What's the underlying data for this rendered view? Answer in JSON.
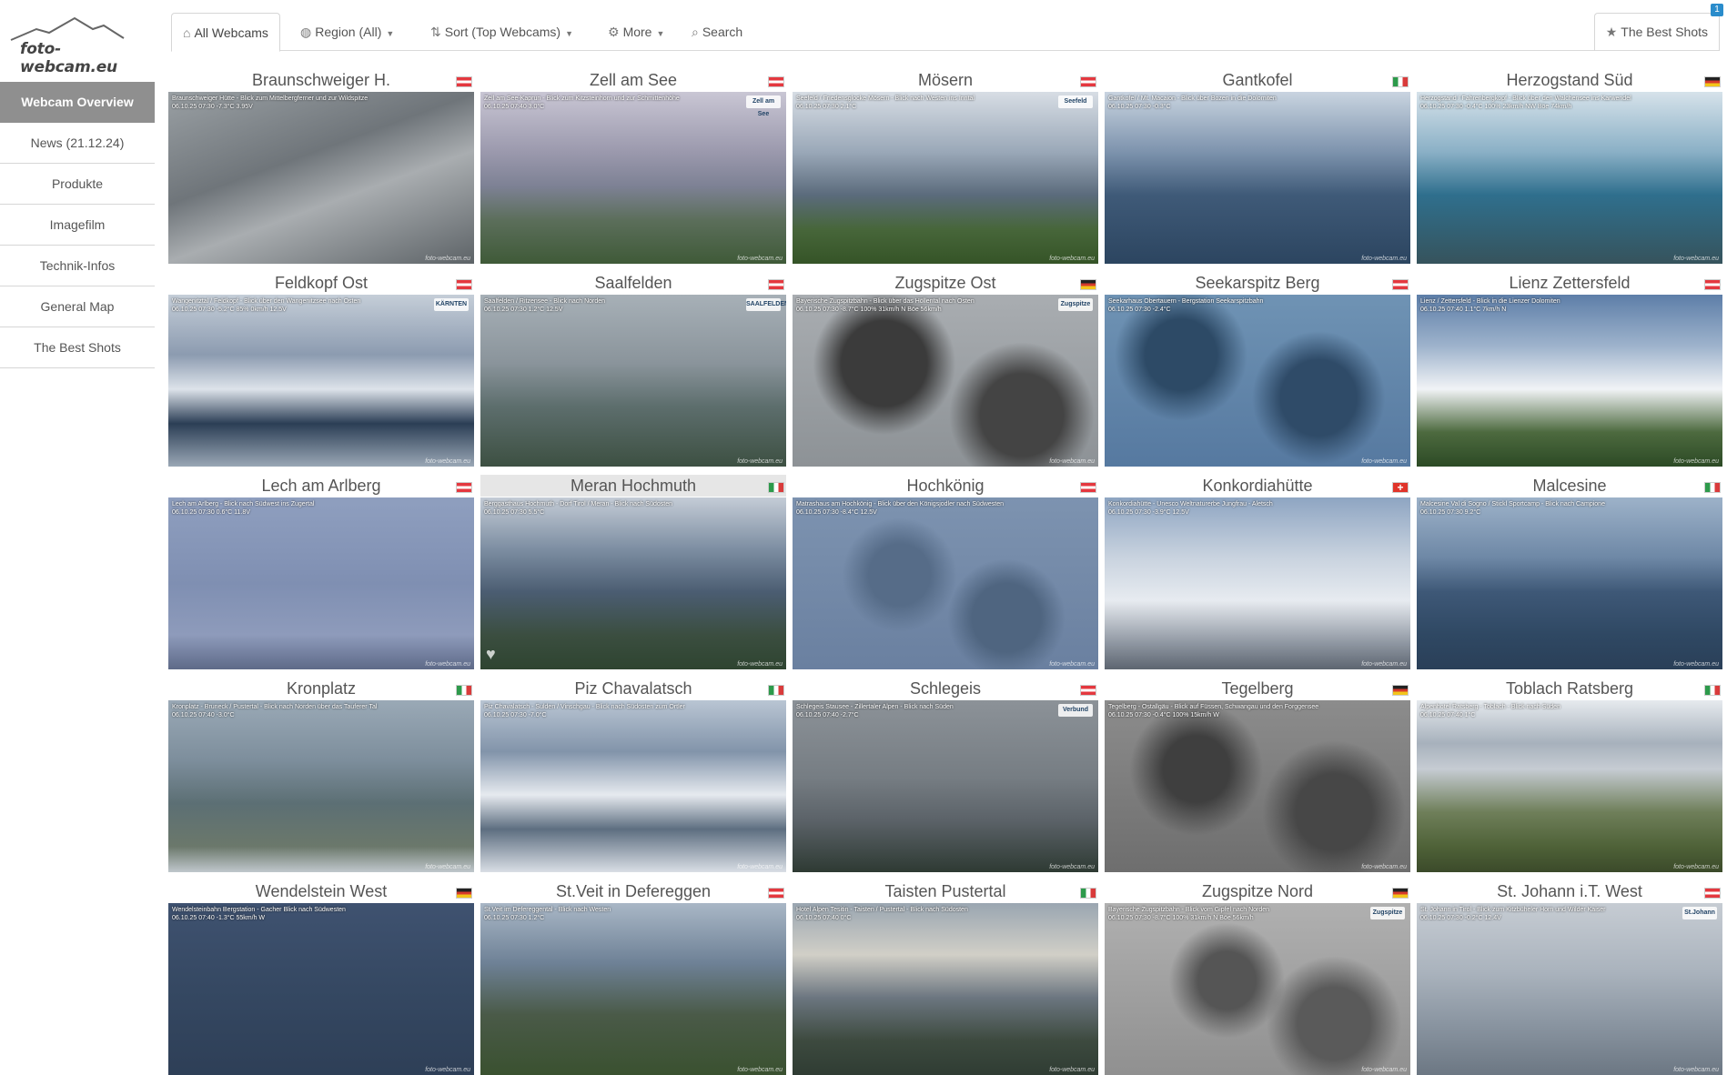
{
  "brand": {
    "name": "foto-webcam.eu"
  },
  "sidebar": {
    "items": [
      {
        "label": "Webcam Overview",
        "active": true
      },
      {
        "label": "News (21.12.24)"
      },
      {
        "label": "Produkte"
      },
      {
        "label": "Imagefilm"
      },
      {
        "label": "Technik-Infos"
      },
      {
        "label": "General Map"
      },
      {
        "label": "The Best Shots"
      }
    ]
  },
  "nav": {
    "all": "All Webcams",
    "region": "Region (All)",
    "sort": "Sort (Top Webcams)",
    "more": "More",
    "search": "Search",
    "best": "The Best Shots",
    "corner": "1"
  },
  "webcams": [
    {
      "title": "Braunschweiger H.",
      "flag": "at",
      "caption": "Braunschweiger Hütte - Blick zum Mittelbergferner und zur Wildspitze",
      "stats": "06.10.25 07:30  -7.3°C  3.95V",
      "bg": "linear-gradient(160deg,#9aa0a4 0%,#6f757a 40%,#a9adb0 60%,#5d6367 100%)"
    },
    {
      "title": "Zell am See",
      "flag": "at",
      "caption": "Zell am See-Kaprun - Blick zum Kitzsteinhorn und zur Schmittenhöhe",
      "stats": "06.10.25 07:40  3.0°C",
      "logo": "Zell am See",
      "bg": "linear-gradient(180deg,#c9c6d4 0%,#9b99ad 35%,#7d8194 55%,#5b6e5a 75%,#3f5a38 100%)"
    },
    {
      "title": "Mösern",
      "flag": "at",
      "caption": "Seefeld / Friedensglocke Mösern - Blick nach Westen ins Inntal",
      "stats": "06.10.25 07:30  2.1°C",
      "logo": "Seefeld",
      "bg": "linear-gradient(180deg,#d7dde4 0%,#9aa8b8 35%,#5b6b7c 60%,#47663a 80%,#355427 100%)"
    },
    {
      "title": "Gantkofel",
      "flag": "it",
      "caption": "Gantkofel / Mt. Macaion - Blick über Bozen in die Dolomiten",
      "stats": "06.10.25 07:30  -0.3°C",
      "bg": "linear-gradient(180deg,#c9d4e0 0%,#7d93ad 35%,#3f5a78 60%,#2c4560 100%)"
    },
    {
      "title": "Herzogstand Süd",
      "flag": "de",
      "caption": "Herzogstand / Fahrenbergkopf - Blick über den Walchensee ins Karwendel",
      "stats": "06.10.25 07:30  -0.4°C  100%  23km/h NW  Böe 74km/h",
      "bg": "linear-gradient(180deg,#d6e2ea 0%,#8ab0c6 35%,#2f6f8d 60%,#36535c 100%)"
    },
    {
      "title": "Feldkopf Ost",
      "flag": "at",
      "caption": "Wangenitztal / Feldkopf - Blick über den Wangenitzsee nach Osten",
      "stats": "06.10.25 07:30  -5.2°C  85%  0km/h  12.5V",
      "logo": "KÄRNTEN",
      "bg": "linear-gradient(180deg,#c5ced8 0%,#8c9bb0 35%,#dde3ea 55%,#2b3e55 75%,#9aa7b5 100%)"
    },
    {
      "title": "Saalfelden",
      "flag": "at",
      "caption": "Saalfelden / Ritzensee - Blick nach Norden",
      "stats": "06.10.25 07:30  1.2°C  12.5V",
      "logo": "SAALFELDEN",
      "bg": "linear-gradient(180deg,#a7b0b7 0%,#8a949b 40%,#5d6e6d 65%,#3d5042 100%)"
    },
    {
      "title": "Zugspitze Ost",
      "flag": "de",
      "caption": "Bayerische Zugspitzbahn - Blick über das Höllental nach Osten",
      "stats": "06.10.25 07:30  -8.7°C  100%  31km/h N  Böe 56km/h",
      "logo": "Zugspitze",
      "bg": "radial-gradient(circle at 30% 40%,#3b3b3b 0 18%,transparent 30%),radial-gradient(circle at 75% 70%,#444 0 16%,transparent 28%),linear-gradient(180deg,#a9adb1,#8d9296)"
    },
    {
      "title": "Seekarspitz Berg",
      "flag": "at",
      "caption": "Seekarhaus Obertauern - Bergstation Seekarspitzbahn",
      "stats": "06.10.25 07:30  -2.4°C",
      "bg": "radial-gradient(circle at 25% 35%,#2d4a66 0 14%,transparent 26%),radial-gradient(circle at 70% 60%,#2f4b68 0 16%,transparent 28%),linear-gradient(180deg,#6f93b4,#5679a0)"
    },
    {
      "title": "Lienz Zettersfeld",
      "flag": "at",
      "caption": "Lienz / Zettersfeld - Blick in die Lienzer Dolomiten",
      "stats": "06.10.25 07:40  1.1°C  7km/h N",
      "bg": "linear-gradient(180deg,#5d7ea8 0%,#9eb3cc 30%,#f1f3f6 55%,#4d6a3f 80%,#2c4a25 100%)"
    },
    {
      "title": "Lech am Arlberg",
      "flag": "at",
      "caption": "Lech am Arlberg - Blick nach Südwest ins Zugertal",
      "stats": "06.10.25 07:30  0.6°C  11.8V",
      "bg": "linear-gradient(180deg,#8f9fbf 0%,#7f8fb2 50%,#8e9bbb 80%,#5e6a88 100%)"
    },
    {
      "title": "Meran Hochmuth",
      "flag": "it",
      "highlight": true,
      "caption": "Berggasthaus Hochmuth - Dorf Tirol / Meran - Blick nach Südosten",
      "stats": "06.10.25 07:30  5.5°C",
      "heart": true,
      "bg": "linear-gradient(180deg,#c4ccd6 0%,#7d8ea2 30%,#4b5d72 55%,#3b4e40 80%,#2e4430 100%)"
    },
    {
      "title": "Hochkönig",
      "flag": "at",
      "caption": "Matrashaus am Hochkönig - Blick über den Königsjodler nach Südwesten",
      "stats": "06.10.25 07:30  -8.4°C  12.5V",
      "bg": "radial-gradient(circle at 35% 45%,#566c88 0 14%,transparent 26%),radial-gradient(circle at 70% 70%,#4f6580 0 14%,transparent 24%),linear-gradient(180deg,#7d93b0,#6a80a0)"
    },
    {
      "title": "Konkordiahütte",
      "flag": "ch",
      "caption": "Konkordiahütte - Unesco Weltnaturerbe Jungfrau - Aletsch",
      "stats": "06.10.25 07:30  -3.9°C  12.5V",
      "bg": "linear-gradient(180deg,#8ea5c2 0%,#c9d3df 35%,#e7ebf0 60%,#8e96a1 85%,#5d6570 100%)"
    },
    {
      "title": "Malcesine",
      "flag": "it",
      "caption": "Malcesine Val di Sogno / Stickl Sportcamp - Blick nach Campione",
      "stats": "06.10.25 07:30  9.2°C",
      "bg": "linear-gradient(180deg,#9db2c9 0%,#6e88a6 35%,#3e5877 55%,#2f4863 80%,#2a3f58 100%)"
    },
    {
      "title": "Kronplatz",
      "flag": "it",
      "caption": "Kronplatz - Bruneck / Pustertal - Blick nach Norden über das Tauferer Tal",
      "stats": "06.10.25 07:40  -3.0°C",
      "bg": "linear-gradient(180deg,#9aa9b6 0%,#7d8e9c 35%,#5c6f74 60%,#6b786b 85%,#c0c7cc 100%)"
    },
    {
      "title": "Piz Chavalatsch",
      "flag": "it",
      "caption": "Piz Chavalatsch - Sulden / Vinschgau - Blick nach Südosten zum Ortler",
      "stats": "06.10.25 07:30  -7.0°C",
      "bg": "linear-gradient(180deg,#b9c5d3 0%,#8294aa 30%,#e6eaef 55%,#5d6e80 75%,#d9dee5 100%)"
    },
    {
      "title": "Schlegeis",
      "flag": "at",
      "caption": "Schlegeis Stausee - Zillertaler Alpen - Blick nach Süden",
      "stats": "06.10.25 07:40  -2.7°C",
      "logo": "Verbund",
      "bg": "linear-gradient(180deg,#8c9298 0%,#767d83 45%,#5b6268 70%,#2e3a33 100%)"
    },
    {
      "title": "Tegelberg",
      "flag": "de",
      "caption": "Tegelberg - Ostallgäu - Blick auf Füssen, Schwangau und den Forggensee",
      "stats": "06.10.25 07:30  -0.4°C  100%  15km/h W",
      "bg": "radial-gradient(circle at 30% 40%,#3f3f3f 0 14%,transparent 28%),radial-gradient(circle at 75% 65%,#474747 0 15%,transparent 28%),linear-gradient(180deg,#8c8c8c,#6e6e6e)"
    },
    {
      "title": "Toblach Ratsberg",
      "flag": "it",
      "caption": "Alpenhotel Ratsberg - Toblach - Blick nach Süden",
      "stats": "06.10.25 07:40  1°C",
      "bg": "linear-gradient(180deg,#e6eaee 0%,#a7b1bc 25%,#c6ccd3 40%,#6f7f5a 65%,#4f6238 85%,#3b4a2a 100%)"
    },
    {
      "title": "Wendelstein West",
      "flag": "de",
      "caption": "Wendelsteinbahn Bergstation - Gacher Blick nach Südwesten",
      "stats": "06.10.25 07:40  -1.3°C  55km/h W",
      "bg": "linear-gradient(180deg,#3f5270 0%,#354862 50%,#2e3f57 100%)"
    },
    {
      "title": "St.Veit in Defereggen",
      "flag": "at",
      "caption": "St.Veit im Defereggental - Blick nach Westen",
      "stats": "06.10.25 07:30  1.2°C",
      "bg": "linear-gradient(180deg,#a9b7c6 0%,#6e8196 35%,#4a5a48 65%,#3a5130 100%)"
    },
    {
      "title": "Taisten Pustertal",
      "flag": "it",
      "caption": "Hotel Alpen Tesitin - Taisten / Pustertal - Blick nach Südosten",
      "stats": "06.10.25 07:40  0°C",
      "bg": "linear-gradient(180deg,#9aa6b1 0%,#d1cfc7 30%,#6c7680 55%,#3d4a3f 80%,#2f3c33 100%)"
    },
    {
      "title": "Zugspitze Nord",
      "flag": "de",
      "caption": "Bayerische Zugspitzbahn - Blick vom Gipfel nach Norden",
      "stats": "06.10.25 07:30  -8.7°C  100%  31km/h N  Böe 56km/h",
      "logo": "Zugspitze",
      "bg": "radial-gradient(circle at 40% 45%,#555 0 14%,transparent 28%),radial-gradient(circle at 75% 70%,#5a5a5a 0 14%,transparent 26%),linear-gradient(180deg,#b0b0b0,#909090)"
    },
    {
      "title": "St. Johann i.T. West",
      "flag": "at",
      "caption": "St. Johann in Tirol - Blick zum Kitzbüheler Horn und Wilder Kaiser",
      "stats": "06.10.25 07:30  -0.2°C  12.4V",
      "logo": "St.Johann",
      "bg": "linear-gradient(180deg,#c6ccd3 0%,#aab3bd 40%,#8a95a1 70%,#6c7783 100%)"
    }
  ],
  "watermark": "foto-webcam.eu"
}
